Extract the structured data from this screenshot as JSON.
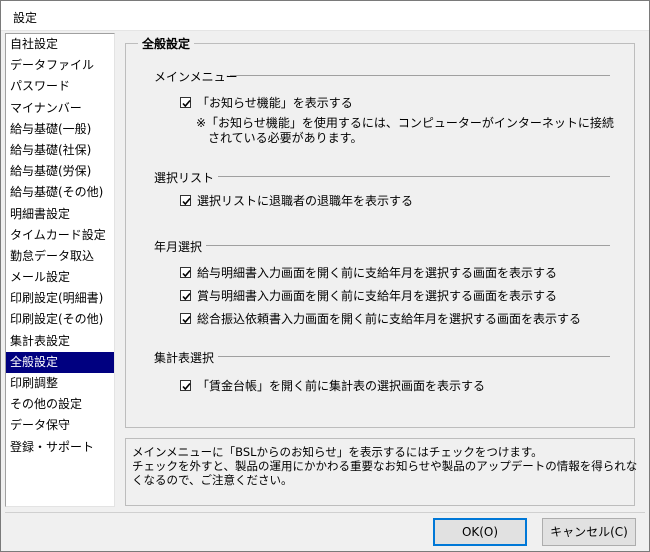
{
  "window": {
    "title": "設定"
  },
  "sidebar": {
    "items": [
      "自社設定",
      "データファイル",
      "パスワード",
      "マイナンバー",
      "給与基礎(一般)",
      "給与基礎(社保)",
      "給与基礎(労保)",
      "給与基礎(その他)",
      "明細書設定",
      "タイムカード設定",
      "勤怠データ取込",
      "メール設定",
      "印刷設定(明細書)",
      "印刷設定(その他)",
      "集計表設定",
      "全般設定",
      "印刷調整",
      "その他の設定",
      "データ保守",
      "登録・サポート"
    ],
    "selected": "全般設定"
  },
  "panel": {
    "title": "全般設定",
    "sections": {
      "main_menu": {
        "heading": "メインメニュー",
        "check1": "「お知らせ機能」を表示する",
        "note_line1": "※「お知らせ機能」を使用するには、コンピューターがインターネットに接続",
        "note_line2": "されている必要があります。"
      },
      "select_list": {
        "heading": "選択リスト",
        "check1": "選択リストに退職者の退職年を表示する"
      },
      "year_month": {
        "heading": "年月選択",
        "check1": "給与明細書入力画面を開く前に支給年月を選択する画面を表示する",
        "check2": "賞与明細書入力画面を開く前に支給年月を選択する画面を表示する",
        "check3": "総合振込依頼書入力画面を開く前に支給年月を選択する画面を表示する"
      },
      "summary_select": {
        "heading": "集計表選択",
        "check1": "「賃金台帳」を開く前に集計表の選択画面を表示する"
      }
    }
  },
  "info": {
    "line1": "メインメニューに「BSLからのお知らせ」を表示するにはチェックをつけます。",
    "line2": "チェックを外すと、製品の運用にかかわる重要なお知らせや製品のアップデートの情報を得られな",
    "line3": "くなるので、ご注意ください。"
  },
  "buttons": {
    "ok": "OK(O)",
    "cancel": "キャンセル(C)"
  },
  "colors": {
    "selection": "#000080",
    "default_button_border": "#0078d7"
  }
}
